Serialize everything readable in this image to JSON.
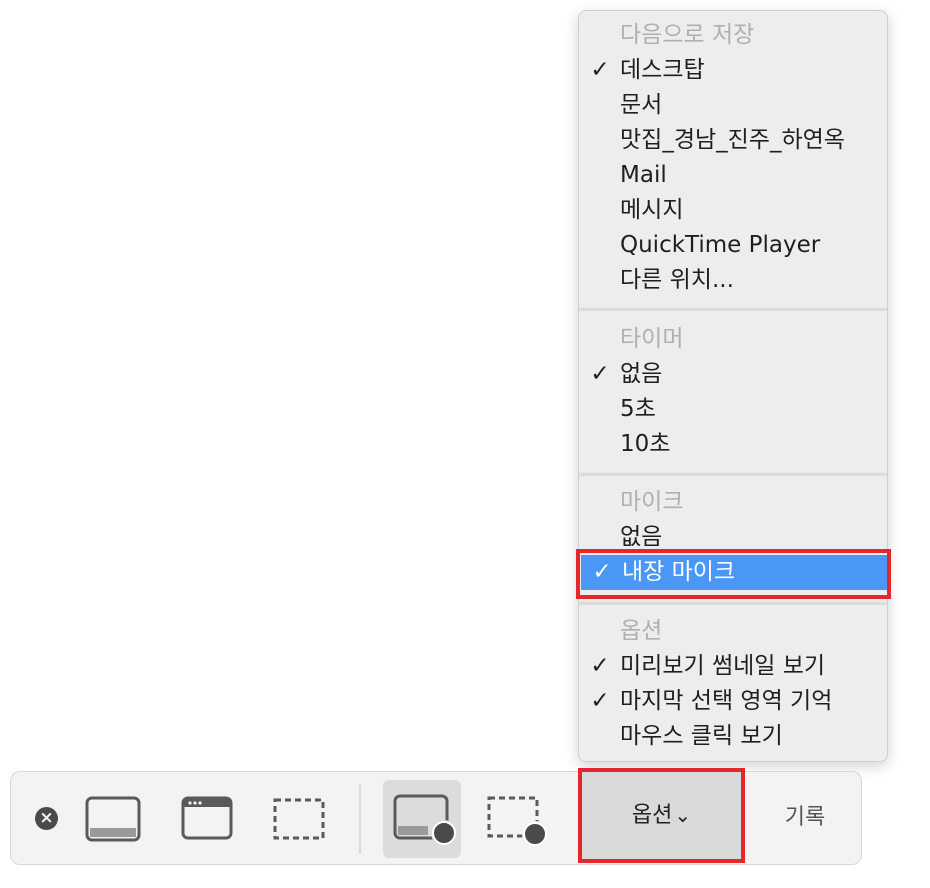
{
  "menu": {
    "save_to": {
      "header": "다음으로 저장",
      "items": [
        {
          "label": "데스크탑",
          "checked": true
        },
        {
          "label": "문서",
          "checked": false
        },
        {
          "label": "맛집_경남_진주_하연옥",
          "checked": false
        },
        {
          "label": "Mail",
          "checked": false
        },
        {
          "label": "메시지",
          "checked": false
        },
        {
          "label": "QuickTime Player",
          "checked": false
        },
        {
          "label": "다른 위치...",
          "checked": false
        }
      ]
    },
    "timer": {
      "header": "타이머",
      "items": [
        {
          "label": "없음",
          "checked": true
        },
        {
          "label": "5초",
          "checked": false
        },
        {
          "label": "10초",
          "checked": false
        }
      ]
    },
    "microphone": {
      "header": "마이크",
      "items": [
        {
          "label": "없음",
          "checked": false
        },
        {
          "label": "내장 마이크",
          "checked": true,
          "selected": true
        }
      ]
    },
    "options": {
      "header": "옵션",
      "items": [
        {
          "label": "미리보기 썸네일 보기",
          "checked": true
        },
        {
          "label": "마지막 선택 영역 기억",
          "checked": true
        },
        {
          "label": "마우스 클릭 보기",
          "checked": false
        }
      ]
    },
    "checkmark": "✓"
  },
  "toolbar": {
    "close_glyph": "×",
    "options_label": "옵션",
    "options_chevron": "⌄",
    "record_label": "기록",
    "tools": [
      {
        "name": "capture-entire-screen",
        "icon": "screen-icon",
        "active": false
      },
      {
        "name": "capture-window",
        "icon": "window-icon",
        "active": false
      },
      {
        "name": "capture-selection",
        "icon": "selection-icon",
        "active": false
      },
      {
        "name": "record-entire-screen",
        "icon": "record-screen-icon",
        "active": true
      },
      {
        "name": "record-selection",
        "icon": "record-selection-icon",
        "active": false
      }
    ]
  },
  "colors": {
    "selection_blue": "#4a97f5",
    "highlight_red": "#e4262d"
  }
}
